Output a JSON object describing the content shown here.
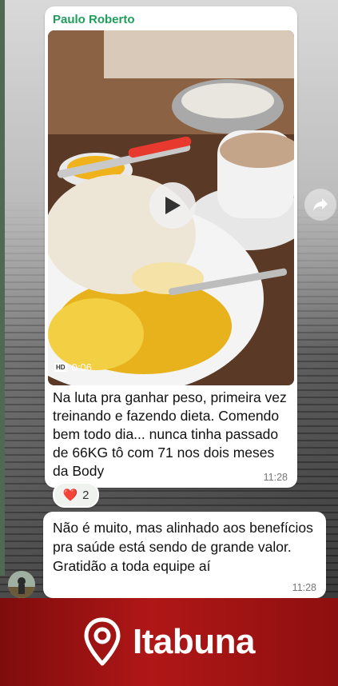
{
  "message1": {
    "sender": "Paulo Roberto",
    "video_quality": "HD",
    "video_duration": "0:06",
    "caption": "Na luta pra ganhar peso, primeira vez treinando e fazendo dieta. Comendo bem todo dia... nunca tinha passado de 66KG tô com 71 nos dois meses da Body",
    "time": "11:28",
    "reaction": {
      "emoji": "❤️",
      "count": "2"
    }
  },
  "message2": {
    "caption": "Não é muito, mas alinhado aos benefícios pra saúde está sendo de grande valor. Gratidão a toda equipe aí",
    "time": "11:28"
  },
  "banner": {
    "city": "Itabuna"
  },
  "icons": {
    "play": "play-icon",
    "forward": "forward-icon",
    "location": "location-pin-icon",
    "hd": "hd-icon"
  },
  "colors": {
    "sender": "#1f9d5b",
    "banner": "#b01717",
    "bubble": "#ffffff"
  }
}
